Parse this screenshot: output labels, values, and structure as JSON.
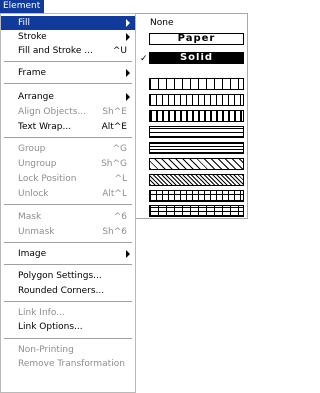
{
  "menu_title": "Element",
  "menu": {
    "fill": "Fill",
    "stroke": "Stroke",
    "fill_and_stroke": "Fill and Stroke ...",
    "fill_and_stroke_shortcut": "^U",
    "frame": "Frame",
    "arrange": "Arrange",
    "align_objects": "Align Objects...",
    "align_objects_shortcut": "Sh^E",
    "text_wrap": "Text Wrap...",
    "text_wrap_shortcut": "Alt^E",
    "group": "Group",
    "group_shortcut": "^G",
    "ungroup": "Ungroup",
    "ungroup_shortcut": "Sh^G",
    "lock_position": "Lock Position",
    "lock_position_shortcut": "^L",
    "unlock": "Unlock",
    "unlock_shortcut": "Alt^L",
    "mask": "Mask",
    "mask_shortcut": "^6",
    "unmask": "Unmask",
    "unmask_shortcut": "Sh^6",
    "image": "Image",
    "polygon_settings": "Polygon Settings...",
    "rounded_corners": "Rounded Corners...",
    "link_info": "Link Info...",
    "link_options": "Link Options...",
    "non_printing": "Non-Printing",
    "remove_transformation": "Remove Transformation"
  },
  "fill_submenu": {
    "none": "None",
    "paper": "Paper",
    "solid": "Solid",
    "checkmark": "✓",
    "selected": "Solid"
  },
  "colors": {
    "highlight": "#103a9c",
    "disabled_text": "#8e8e8e"
  }
}
